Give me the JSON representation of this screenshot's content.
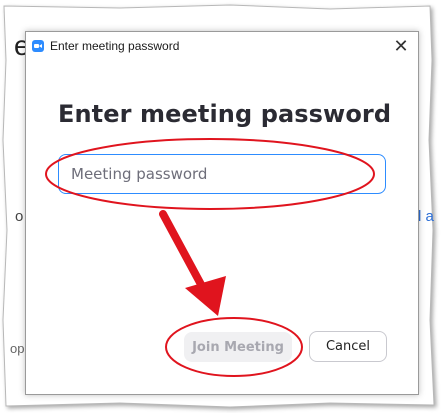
{
  "background": {
    "fragment_e": "e",
    "fragment_o": "o",
    "fragment_a": "l a",
    "fragment_op": "op"
  },
  "dialog": {
    "window_title": "Enter meeting password",
    "heading": "Enter meeting password",
    "password_field": {
      "placeholder": "Meeting password",
      "value": ""
    },
    "join_button_label": "Join Meeting",
    "cancel_button_label": "Cancel",
    "close_glyph": "✕"
  },
  "colors": {
    "accent": "#2d8cff",
    "annotation_red": "#e0141e"
  },
  "icons": {
    "app": "zoom-camera-icon",
    "close": "close-icon"
  }
}
